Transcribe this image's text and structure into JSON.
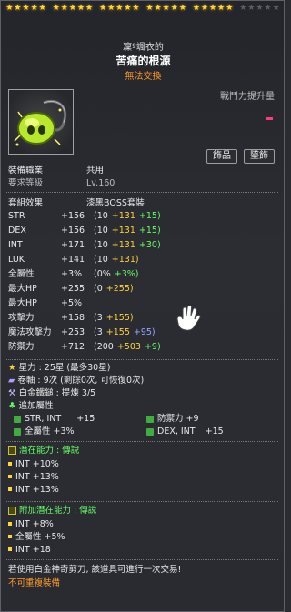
{
  "stars": {
    "groups": [
      5,
      5,
      5,
      5,
      5,
      5
    ],
    "filled": 25,
    "total": 30
  },
  "header": {
    "owner": "凜º颯衣的",
    "item_name": "苦痛的根源",
    "trade": "無法交換"
  },
  "combat_power": {
    "label": "戰鬥力提升量"
  },
  "buttons": {
    "accessory": "飾品",
    "pendant": "墜飾"
  },
  "req": [
    {
      "label": "裝備職業",
      "value": "共用"
    },
    {
      "label": "要求等級",
      "value": "Lv.160"
    }
  ],
  "set_effect": {
    "label": "套組效果",
    "value": "漆黑BOSS套裝"
  },
  "stats": [
    {
      "name": "STR",
      "total": "+156",
      "base": "(10",
      "flame": "+131",
      "scroll": "+15)",
      "extra": ""
    },
    {
      "name": "DEX",
      "total": "+156",
      "base": "(10",
      "flame": "+131",
      "scroll": "+15)",
      "extra": ""
    },
    {
      "name": "INT",
      "total": "+171",
      "base": "(10",
      "flame": "+131",
      "scroll": "+30)",
      "extra": ""
    },
    {
      "name": "LUK",
      "total": "+141",
      "base": "(10",
      "flame": "+131)",
      "scroll": "",
      "extra": ""
    },
    {
      "name": "全屬性",
      "total": "+3%",
      "base": "(0%",
      "flame": "",
      "scroll": "+3%)",
      "extra": ""
    },
    {
      "name": "最大HP",
      "total": "+255",
      "base": "(0",
      "flame": "+255)",
      "scroll": "",
      "extra": ""
    },
    {
      "name": "最大HP",
      "total": "+5%",
      "base": "",
      "flame": "",
      "scroll": "",
      "extra": ""
    },
    {
      "name": "攻擊力",
      "total": "+158",
      "base": "(3",
      "flame": "+155)",
      "scroll": "",
      "extra": ""
    },
    {
      "name": "魔法攻擊力",
      "total": "+253",
      "base": "(3",
      "flame": "+155",
      "scroll": "",
      "extra": "+95)"
    },
    {
      "name": "防禦力",
      "total": "+712",
      "base": "(200",
      "flame": "+503",
      "scroll": "+9)",
      "extra": ""
    }
  ],
  "enhance": [
    {
      "icon": "star-icon",
      "text": "星力 : 25星 (最多30星)"
    },
    {
      "icon": "scroll-icon",
      "text": "卷軸 : 9次 (剩餘0次, 可恢復0次)"
    },
    {
      "icon": "hammer-icon",
      "text": "白金鐵鎚 : 提煉 3/5"
    }
  ],
  "additional": {
    "label": "追加屬性",
    "items": [
      {
        "text": "STR, INT",
        "value": "+15"
      },
      {
        "text": "防禦力",
        "value": "+9"
      },
      {
        "text": "全屬性",
        "value": "+3%"
      },
      {
        "text": "DEX, INT",
        "value": "+15"
      }
    ]
  },
  "potential": {
    "label": "潛在能力 : 傳說",
    "lines": [
      "INT +10%",
      "INT +13%",
      "INT +13%"
    ]
  },
  "bonus_potential": {
    "label": "附加潛在能力 : 傳說",
    "lines": [
      "INT +8%",
      "全屬性 +5%",
      "INT +18"
    ]
  },
  "footer": {
    "scissors": "若使用白金神奇剪刀, 該道具可進行一次交易!",
    "no_reequip": "不可重複裝備"
  },
  "colors": {
    "gold": "#ffd33a",
    "green": "#66ff66",
    "blue": "#9aa8ff",
    "orange": "#ff9a2a"
  }
}
